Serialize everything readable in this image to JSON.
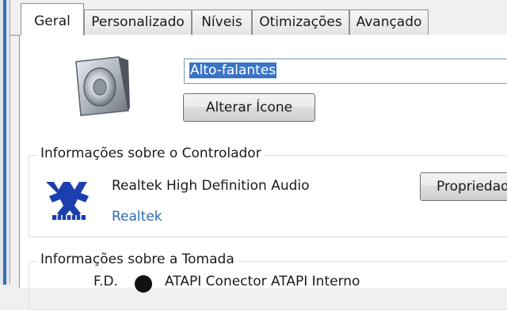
{
  "tabs": [
    "Geral",
    "Personalizado",
    "Níveis",
    "Otimizações",
    "Avançado"
  ],
  "active_tab": "Geral",
  "device_name": "Alto-falantes",
  "change_icon_label": "Alterar Ícone",
  "controller": {
    "title": "Informações sobre o Controlador",
    "name": "Realtek High Definition Audio",
    "vendor": "Realtek",
    "properties_label": "Propriedades"
  },
  "jack": {
    "title": "Informações sobre a Tomada",
    "position": "F.D.",
    "description": "ATAPI Conector ATAPI Interno"
  },
  "colors": {
    "selection": "#3a74c5",
    "link": "#2a6ab5",
    "jack_color": "#111111"
  },
  "icons": [
    "speaker-icon",
    "realtek-logo-icon",
    "jack-color-dot"
  ]
}
